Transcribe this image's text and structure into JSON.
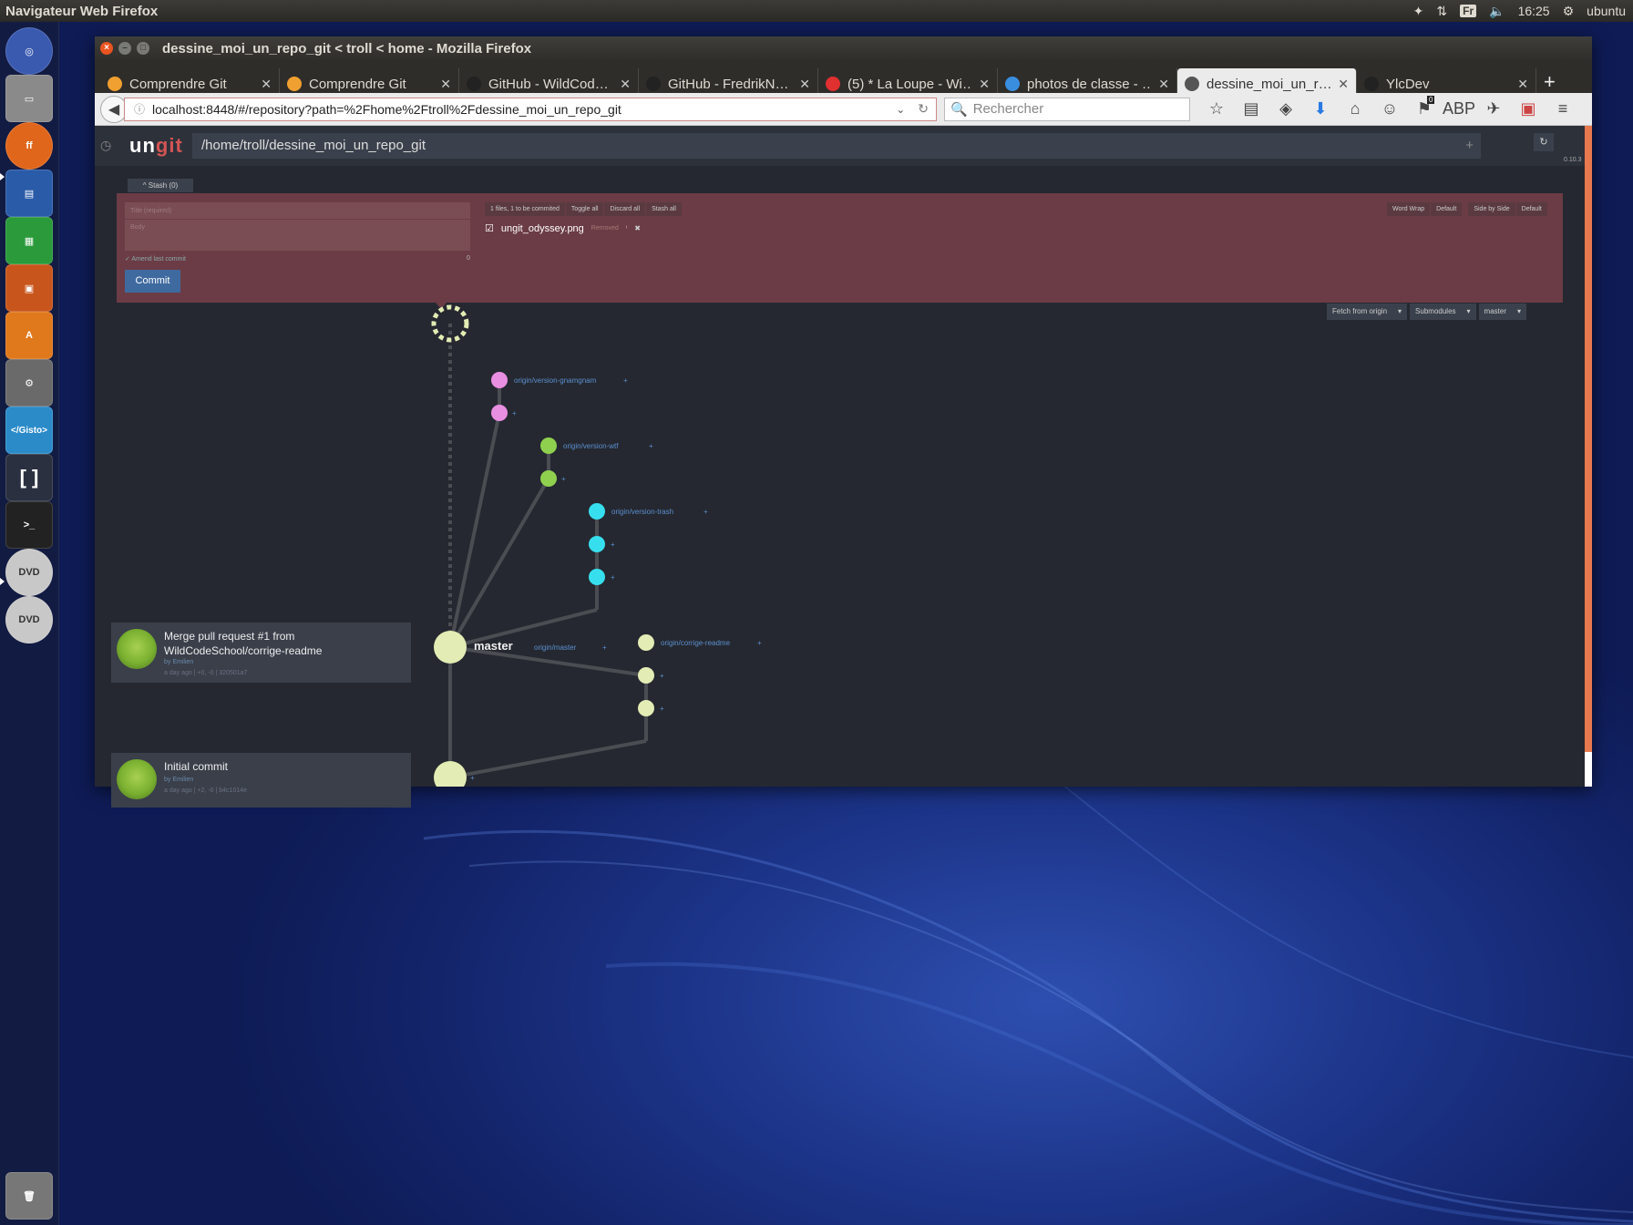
{
  "top_panel": {
    "app": "Navigateur Web Firefox",
    "lang": "Fr",
    "time": "16:25",
    "user": "ubuntu"
  },
  "launcher": [
    "ubuntu-dash",
    "files",
    "firefox",
    "writer",
    "calc",
    "impress",
    "software-center",
    "system-settings",
    "gisto",
    "brackets",
    "terminal",
    "dvd",
    "dvd",
    "trash"
  ],
  "window": {
    "title": "dessine_moi_un_repo_git < troll < home - Mozilla Firefox"
  },
  "tabs": [
    {
      "label": "Comprendre Git",
      "icon_color": "#f0a030"
    },
    {
      "label": "Comprendre Git",
      "icon_color": "#f0a030"
    },
    {
      "label": "GitHub - WildCod…",
      "icon_color": "#222"
    },
    {
      "label": "GitHub - FredrikN…",
      "icon_color": "#222"
    },
    {
      "label": "(5) * La Loupe - Wi…",
      "icon_color": "#e03030"
    },
    {
      "label": "photos de classe - …",
      "icon_color": "#3a8ee0"
    },
    {
      "label": "dessine_moi_un_r…",
      "icon_color": "#555"
    },
    {
      "label": "YlcDev",
      "icon_color": "#222"
    }
  ],
  "nav": {
    "url": "localhost:8448/#/repository?path=%2Fhome%2Ftroll%2Fdessine_moi_un_repo_git",
    "search_placeholder": "Rechercher",
    "notif_count": "0"
  },
  "ungit": {
    "logo_a": "un",
    "logo_b": "git",
    "path": "/home/troll/dessine_moi_un_repo_git",
    "version": "0.10.3",
    "stash": "^ Stash (0)",
    "title_placeholder": "Title (required)",
    "body_placeholder": "Body",
    "amend": "✓ Amend last commit",
    "char_count": "0",
    "commit_label": "Commit",
    "files_info": "1 files, 1 to be commited",
    "toggle_all": "Toggle all",
    "discard_all": "Discard all",
    "stash_all": "Stash all",
    "word_wrap": "Word Wrap",
    "default1": "Default",
    "side_by_side": "Side by Side",
    "default2": "Default",
    "file_name": "ungit_odyssey.png",
    "file_status": "Removed",
    "fetch": "Fetch from origin",
    "submodules": "Submodules",
    "branch": "master",
    "head_branch": "master",
    "refs": {
      "gnamgnam": "origin/version-gnamgnam",
      "wtf": "origin/version-wtf",
      "trash": "origin/version-trash",
      "master": "origin/master",
      "readme": "origin/corrige-readme"
    },
    "commits": [
      {
        "msg": "Merge pull request #1 from WildCodeSchool/corrige-readme",
        "by": "by Emilien",
        "meta": "a day ago | +0, -0 | 320501a7"
      },
      {
        "msg": "Initial commit",
        "by": "by Emilien",
        "meta": "a day ago | +2, -0 | b4c1014e"
      }
    ],
    "colors": {
      "pink": "#e98fe2",
      "green": "#8fd14f",
      "cyan": "#37dfee",
      "cream": "#e2ecb4",
      "staging": "#6b3c45"
    }
  }
}
